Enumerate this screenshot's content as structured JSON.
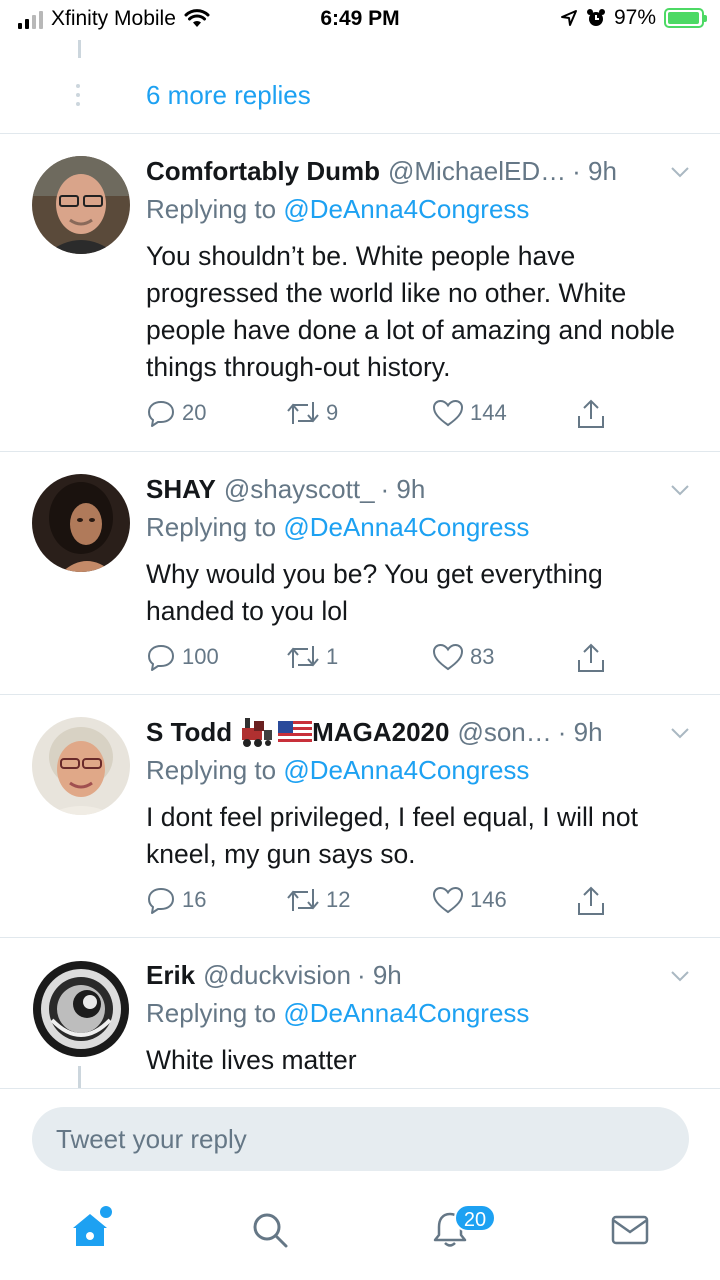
{
  "status_bar": {
    "carrier": "Xfinity Mobile",
    "time": "6:49 PM",
    "battery": "97%",
    "battery_level": 0.97
  },
  "thread": {
    "more_replies": "6 more replies"
  },
  "tweets": [
    {
      "name": "Comfortably Dumb",
      "handle": "@MichaelED…",
      "time": "· 9h",
      "replying_prefix": "Replying to",
      "replying_to": "@DeAnna4Congress",
      "text": "You shouldn’t be. White people have progressed the world like no other. White people have done a lot of amazing and noble things through-out history.",
      "replies": "20",
      "retweets": "9",
      "likes": "144"
    },
    {
      "name": "SHAY",
      "handle": "@shayscott_",
      "time": "· 9h",
      "replying_prefix": "Replying to",
      "replying_to": "@DeAnna4Congress",
      "text": "Why would you be? You get everything handed to you lol",
      "replies": "100",
      "retweets": "1",
      "likes": "83"
    },
    {
      "name": "S Todd",
      "name_suffix": "MAGA2020",
      "handle": "@son…",
      "time": "· 9h",
      "replying_prefix": "Replying to",
      "replying_to": "@DeAnna4Congress",
      "text": "I dont feel privileged, I feel equal, I will not kneel, my gun says so.",
      "replies": "16",
      "retweets": "12",
      "likes": "146"
    },
    {
      "name": "Erik",
      "handle": "@duckvision",
      "time": "· 9h",
      "replying_prefix": "Replying to",
      "replying_to": "@DeAnna4Congress",
      "text": "White lives matter"
    }
  ],
  "reply_bar": {
    "placeholder": "Tweet your reply"
  },
  "tab_bar": {
    "notifications_count": "20"
  },
  "colors": {
    "accent": "#1da1f2",
    "secondary_text": "#657786",
    "divider": "#e1e8ed",
    "battery": "#4cd964"
  }
}
